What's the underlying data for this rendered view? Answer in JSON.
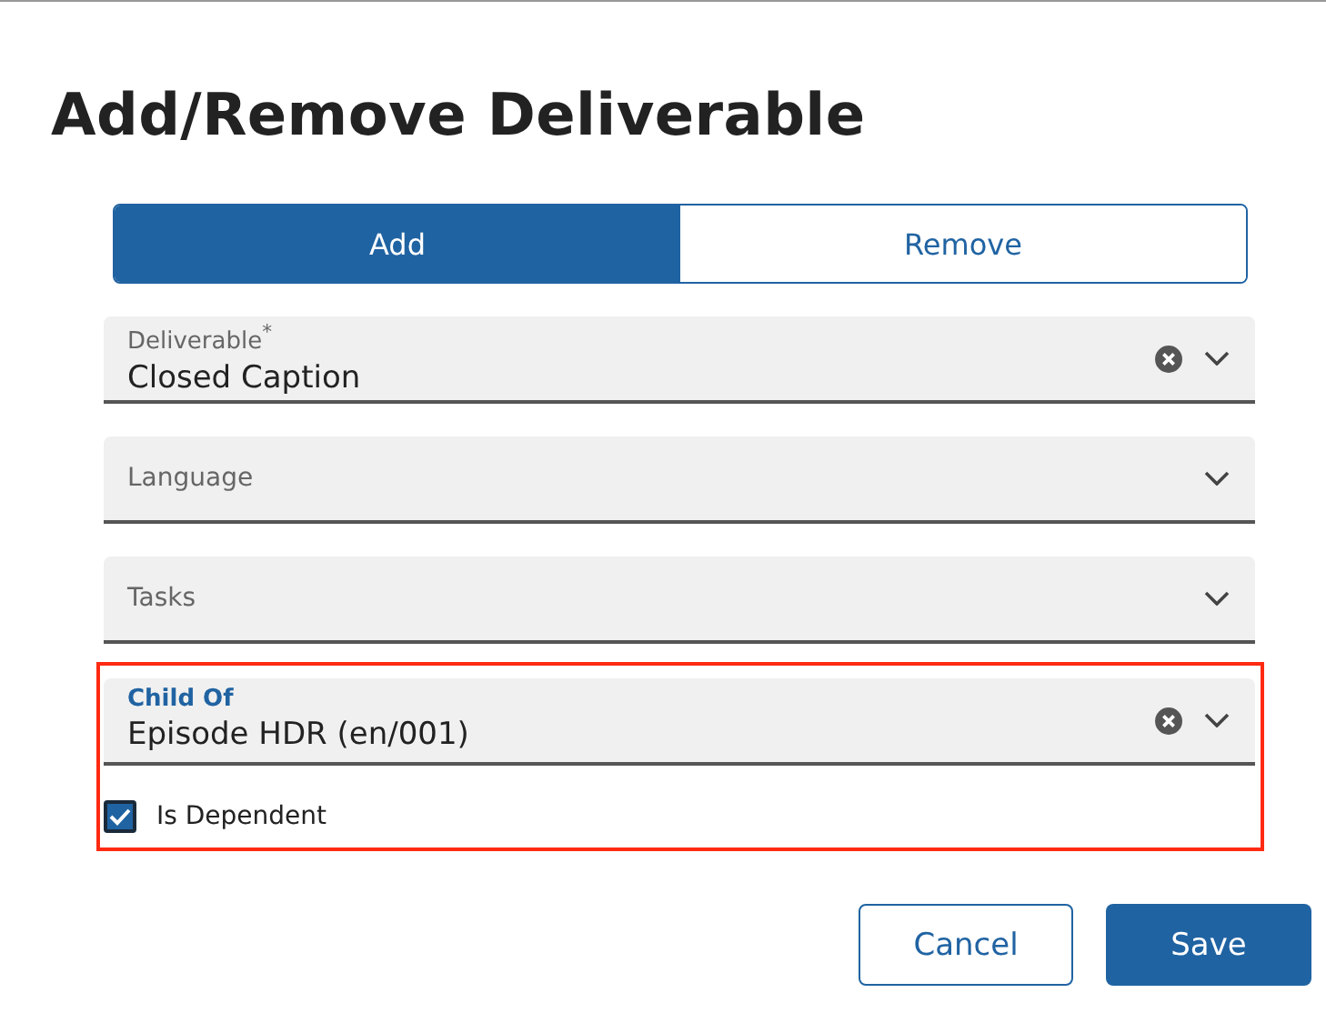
{
  "title": "Add/Remove Deliverable",
  "mode_toggle": [
    {
      "label": "Add",
      "selected": true
    },
    {
      "label": "Remove",
      "selected": false
    }
  ],
  "fields": [
    {
      "label": "Deliverable$^{*}$",
      "value": "Closed Caption",
      "focused": false
    },
    {
      "label": "Language",
      "focused": false
    },
    {
      "label": "Tasks",
      "focused": false
    }
  ],
  "highlighted_section": {
    "field": {
      "label": "Child Of",
      "value": "Episode HDR (en/001)",
      "focused": true
    },
    "checkbox": {
      "label": "Is Dependent",
      "checked": true
    }
  },
  "buttons": [
    {
      "label": "Cancel",
      "kind": "secondary"
    },
    {
      "label": "Save",
      "kind": "primary"
    }
  ]
}
